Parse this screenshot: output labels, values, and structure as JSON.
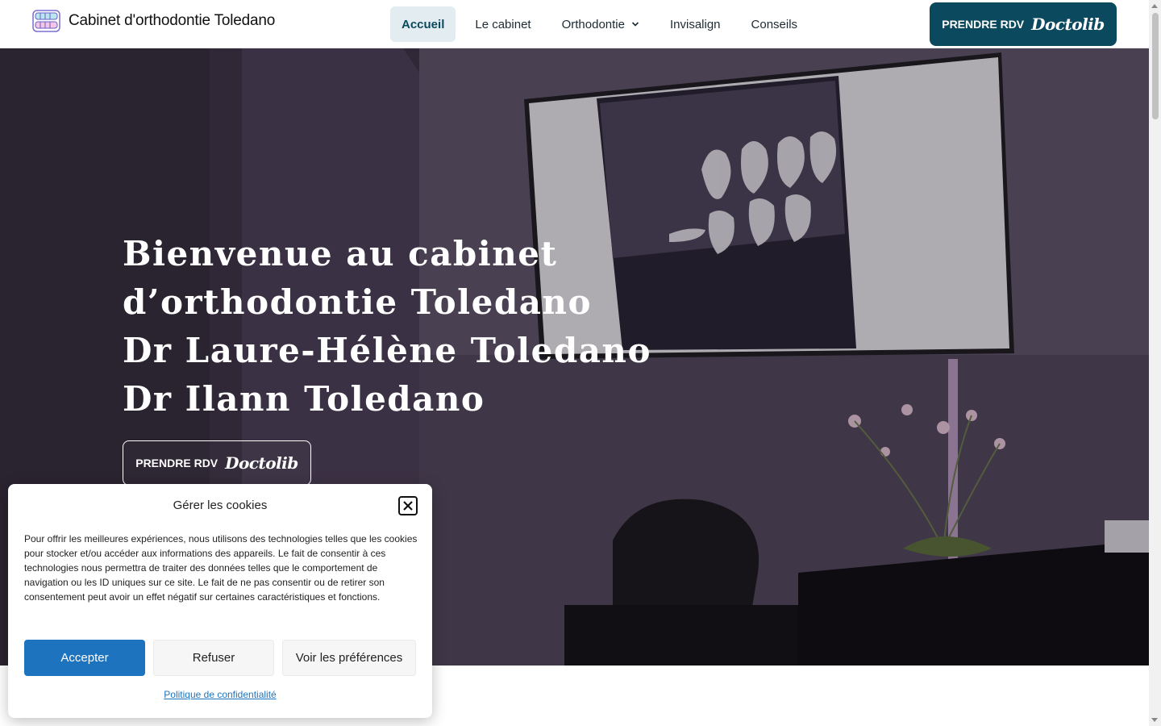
{
  "header": {
    "site_name": "Cabinet d'orthodontie Toledano",
    "logo_icon": "teeth-aligner-icon",
    "nav": [
      {
        "label": "Accueil",
        "active": true
      },
      {
        "label": "Le cabinet",
        "active": false
      },
      {
        "label": "Orthodontie",
        "active": false,
        "has_dropdown": true
      },
      {
        "label": "Invisalign",
        "active": false
      },
      {
        "label": "Conseils",
        "active": false
      }
    ],
    "cta": {
      "label": "PRENDRE RDV",
      "brand": "Doctolib"
    }
  },
  "hero": {
    "title_lines": [
      "Bienvenue au cabinet",
      "d’orthodontie Toledano",
      "Dr Laure-Hélène Toledano",
      "Dr Ilann Toledano"
    ],
    "cta": {
      "label": "PRENDRE RDV",
      "brand": "Doctolib"
    }
  },
  "cookie": {
    "title": "Gérer les cookies",
    "text": "Pour offrir les meilleures expériences, nous utilisons des technologies telles que les cookies pour stocker et/ou accéder aux informations des appareils. Le fait de consentir à ces technologies nous permettra de traiter des données telles que le comportement de navigation ou les ID uniques sur ce site. Le fait de ne pas consentir ou de retirer son consentement peut avoir un effet négatif sur certaines caractéristiques et fonctions.",
    "accept": "Accepter",
    "refuse": "Refuser",
    "preferences": "Voir les préférences",
    "policy_link": "Politique de confidentialité"
  },
  "colors": {
    "primary": "#0b4a5e",
    "nav_active_bg": "#e3ecf0",
    "accept_button": "#1e73be"
  }
}
